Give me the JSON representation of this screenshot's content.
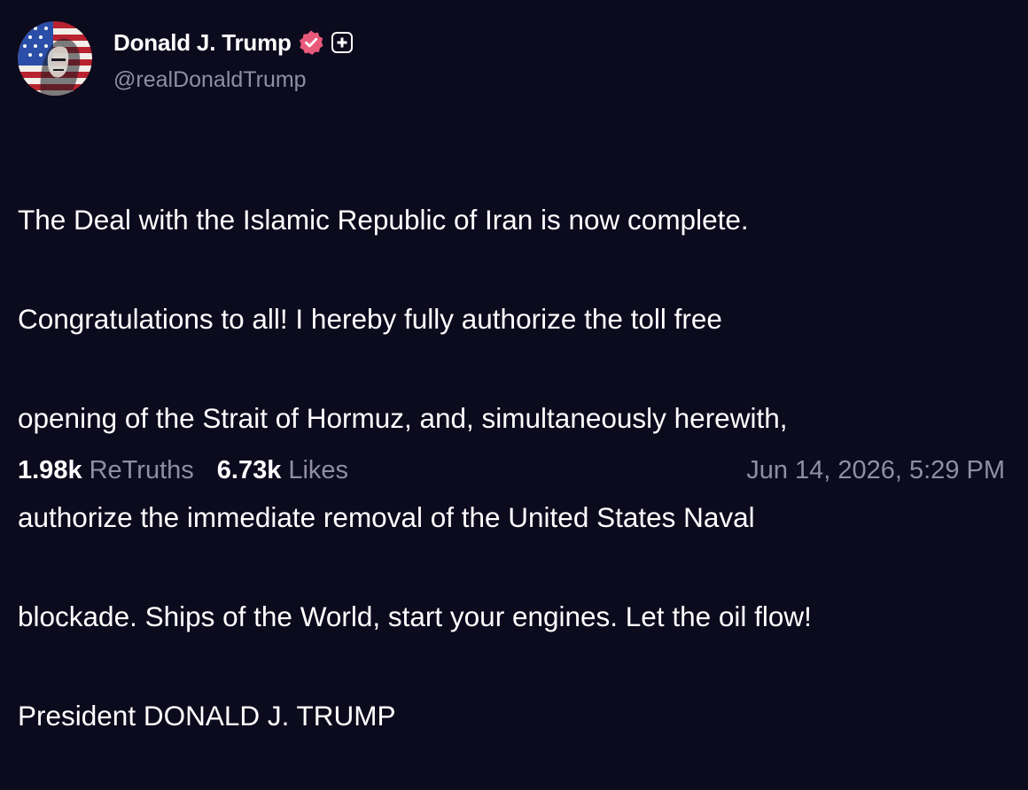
{
  "author": {
    "display_name": "Donald J. Trump",
    "handle": "@realDonaldTrump",
    "avatar_icon": "profile-avatar",
    "verified_icon": "verified-badge-icon",
    "verified_color": "#e95a7a",
    "plus_icon": "plus-badge-icon"
  },
  "post": {
    "lines": [
      "The Deal with the Islamic Republic of Iran is now complete.",
      "Congratulations to all! I hereby fully authorize the toll free",
      "opening of the Strait of Hormuz, and, simultaneously herewith,",
      "authorize the immediate removal of the United States Naval",
      "blockade. Ships of the World, start your engines. Let the oil flow!",
      "President DONALD J. TRUMP"
    ]
  },
  "stats": {
    "retruths_count": "1.98k",
    "retruths_label": "ReTruths",
    "likes_count": "6.73k",
    "likes_label": "Likes"
  },
  "timestamp": "Jun 14, 2026, 5:29 PM",
  "colors": {
    "background": "#0c0a1d",
    "text": "#ffffff",
    "muted": "#8f8ea3"
  }
}
